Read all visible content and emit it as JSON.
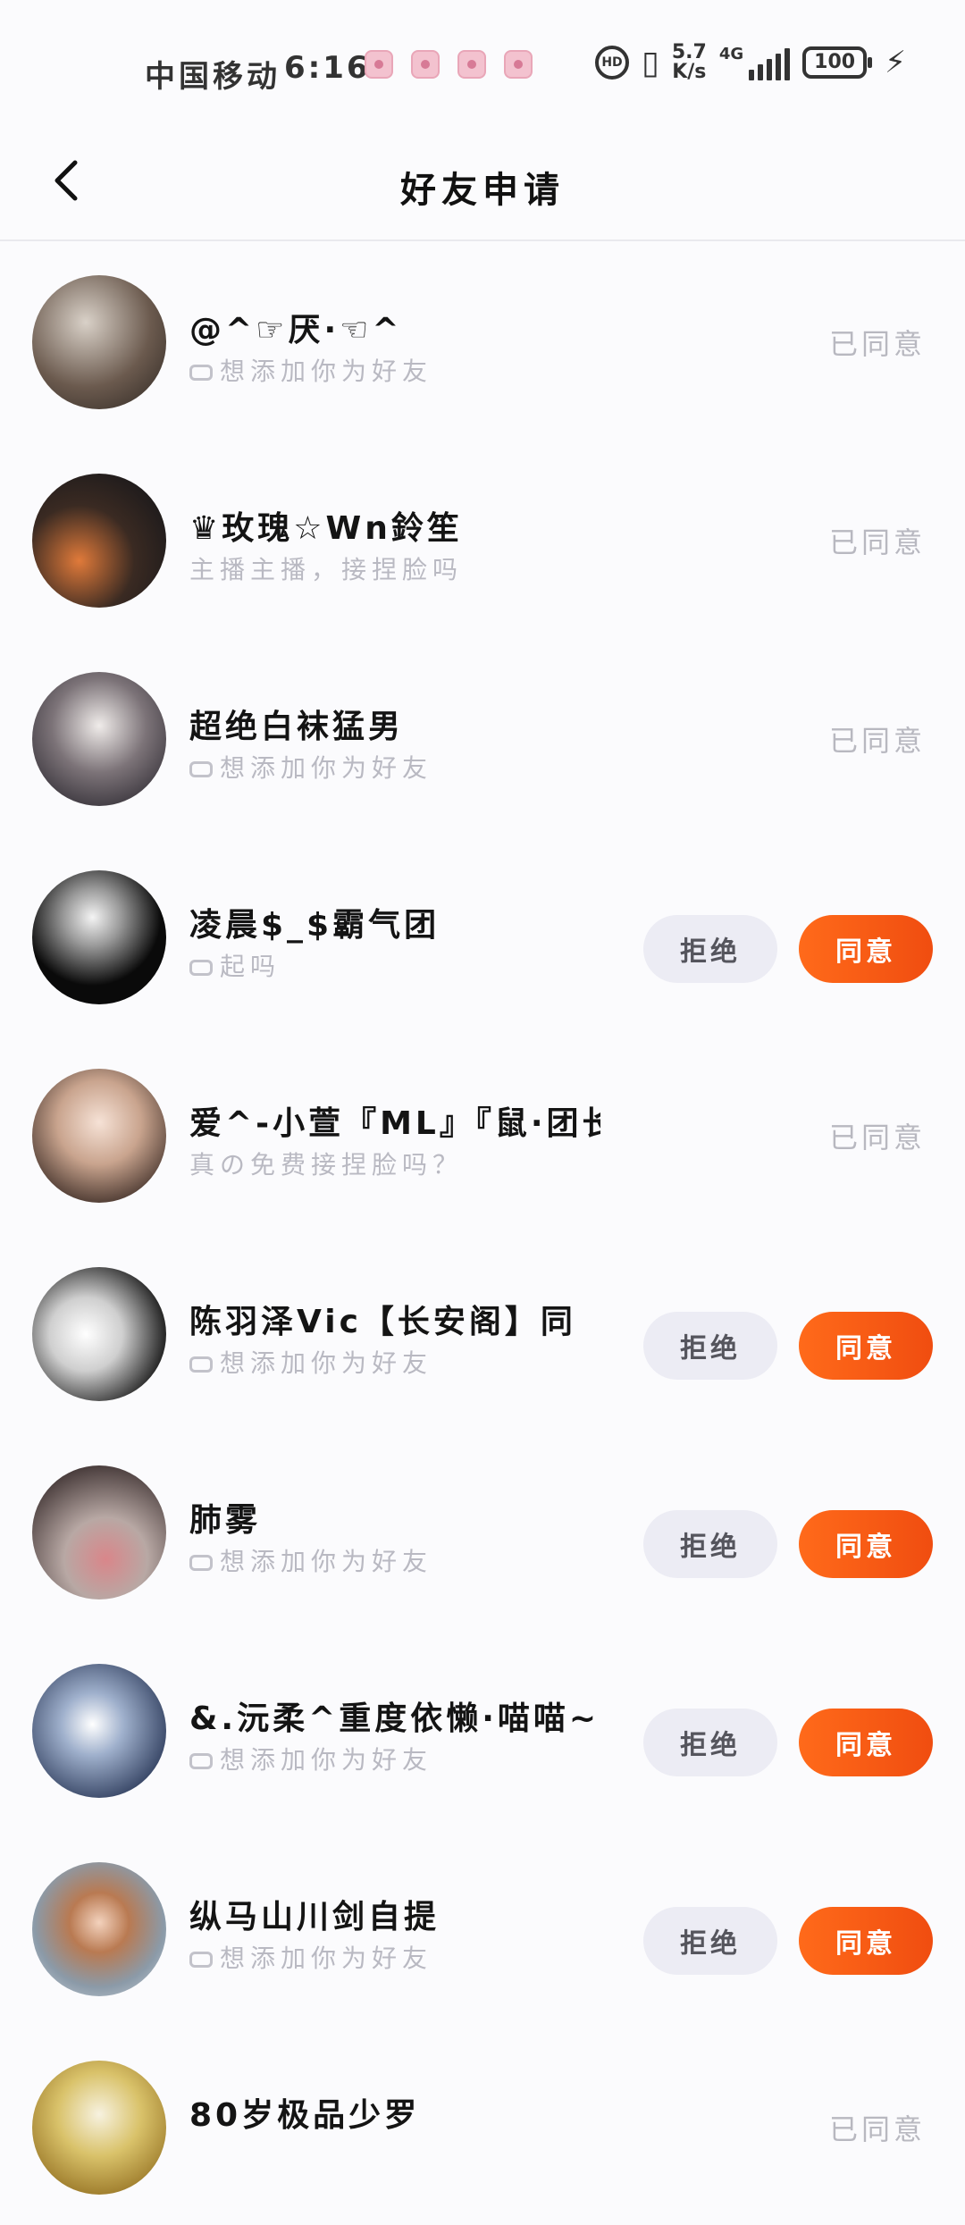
{
  "status_bar": {
    "carrier": "中国移动",
    "time": "6:16",
    "net_speed_value": "5.7",
    "net_speed_unit": "K/s",
    "signal_label": "4G",
    "battery": "100"
  },
  "header": {
    "title": "好友申请"
  },
  "accept_label": "同意",
  "reject_label": "拒绝",
  "done_label": "已同意",
  "requests": [
    {
      "name": "@^☞厌·☜^",
      "message": "想添加你为好友",
      "status": "accepted"
    },
    {
      "name": "♛玫瑰☆Wn鈴笙",
      "message": "主播主播，接捏脸吗",
      "status": "accepted"
    },
    {
      "name": "超绝白袜猛男",
      "message": "想添加你为好友",
      "status": "accepted"
    },
    {
      "name": "凌晨$_$霸气团",
      "message": "起吗",
      "status": "pending"
    },
    {
      "name": "爱^-小萱『ML』『鼠·团长』",
      "message": "真の免费接捏脸吗？",
      "status": "accepted"
    },
    {
      "name": "陈羽泽Vic【长安阁】同",
      "message": "想添加你为好友",
      "status": "pending"
    },
    {
      "name": "肺雾",
      "message": "想添加你为好友",
      "status": "pending"
    },
    {
      "name": "&.沅柔^重度依懒·喵喵~",
      "message": "想添加你为好友",
      "status": "pending"
    },
    {
      "name": "纵马山川剑自提",
      "message": "想添加你为好友",
      "status": "pending"
    },
    {
      "name": "80岁极品少罗",
      "message": "",
      "status": "accepted"
    }
  ]
}
